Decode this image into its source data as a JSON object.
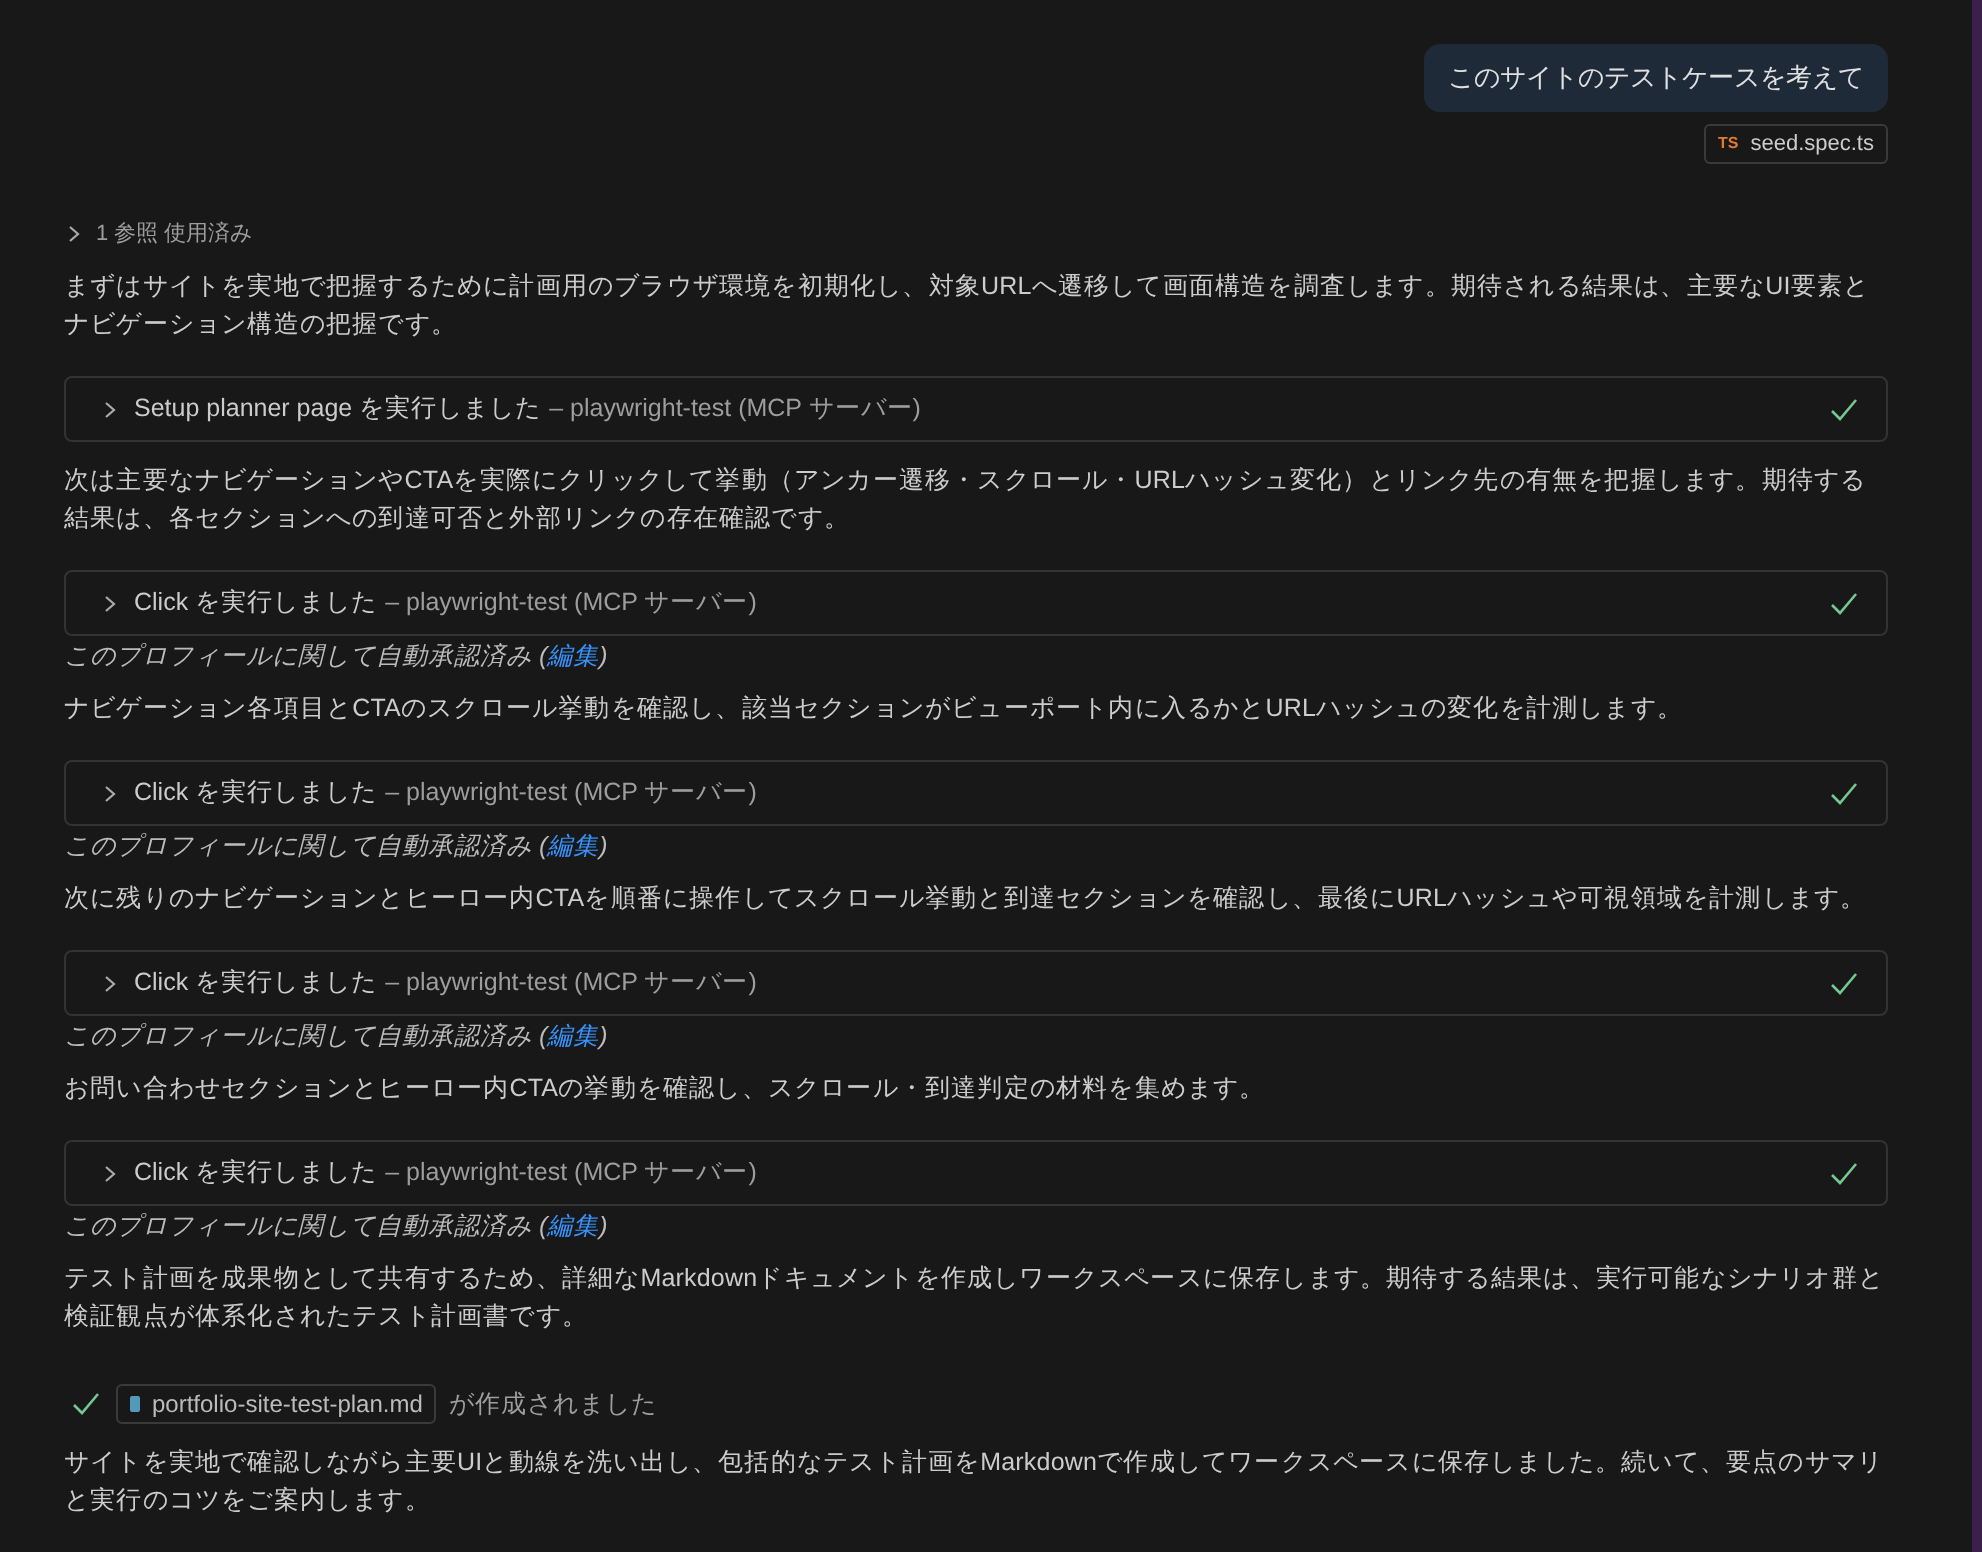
{
  "user_message": {
    "text": "このサイトのテストケースを考えて",
    "attachment": {
      "badge": "TS",
      "name": "seed.spec.ts"
    }
  },
  "items": [
    {
      "kind": "reference",
      "text": "1 参照 使用済み",
      "expanded": false
    },
    {
      "kind": "paragraph",
      "text": "まずはサイトを実地で把握するために計画用のブラウザ環境を初期化し、対象URLへ遷移して画面構造を調査します。期待される結果は、主要なUI要素とナビゲーション構造の把握です。"
    },
    {
      "kind": "tool",
      "action": "Setup planner page を実行しました",
      "server": "– playwright-test (MCP サーバー)",
      "expanded": false,
      "done": true
    },
    {
      "kind": "paragraph",
      "text": "次は主要なナビゲーションやCTAを実際にクリックして挙動（アンカー遷移・スクロール・URLハッシュ変化）とリンク先の有無を把握します。期待する結果は、各セクションへの到達可否と外部リンクの存在確認です。"
    },
    {
      "kind": "tool",
      "action": "Click を実行しました",
      "server": "– playwright-test (MCP サーバー)",
      "expanded": false,
      "done": true
    },
    {
      "kind": "approval",
      "text": "このプロフィールに関して自動承認済み (",
      "link": "編集",
      "suffix": ")"
    },
    {
      "kind": "paragraph",
      "text": "ナビゲーション各項目とCTAのスクロール挙動を確認し、該当セクションがビューポート内に入るかとURLハッシュの変化を計測します。"
    },
    {
      "kind": "tool",
      "action": "Click を実行しました",
      "server": "– playwright-test (MCP サーバー)",
      "expanded": false,
      "done": true
    },
    {
      "kind": "approval",
      "text": "このプロフィールに関して自動承認済み (",
      "link": "編集",
      "suffix": ")"
    },
    {
      "kind": "paragraph",
      "text": "次に残りのナビゲーションとヒーロー内CTAを順番に操作してスクロール挙動と到達セクションを確認し、最後にURLハッシュや可視領域を計測します。"
    },
    {
      "kind": "tool",
      "action": "Click を実行しました",
      "server": "– playwright-test (MCP サーバー)",
      "expanded": false,
      "done": true
    },
    {
      "kind": "approval",
      "text": "このプロフィールに関して自動承認済み (",
      "link": "編集",
      "suffix": ")"
    },
    {
      "kind": "paragraph",
      "text": "お問い合わせセクションとヒーロー内CTAの挙動を確認し、スクロール・到達判定の材料を集めます。"
    },
    {
      "kind": "tool",
      "action": "Click を実行しました",
      "server": "– playwright-test (MCP サーバー)",
      "expanded": false,
      "done": true
    },
    {
      "kind": "approval",
      "text": "このプロフィールに関して自動承認済み (",
      "link": "編集",
      "suffix": ")"
    },
    {
      "kind": "paragraph",
      "text": "テスト計画を成果物として共有するため、詳細なMarkdownドキュメントを作成しワークスペースに保存します。期待する結果は、実行可能なシナリオ群と検証観点が体系化されたテスト計画書です。"
    },
    {
      "kind": "file",
      "name": "portfolio-site-test-plan.md",
      "text": "が作成されました",
      "done": true
    },
    {
      "kind": "paragraph",
      "text": "サイトを実地で確認しながら主要UIと動線を洗い出し、包括的なテスト計画をMarkdownで作成してワークスペースに保存しました。続いて、要点のサマリと実行のコツをご案内します。"
    }
  ]
}
